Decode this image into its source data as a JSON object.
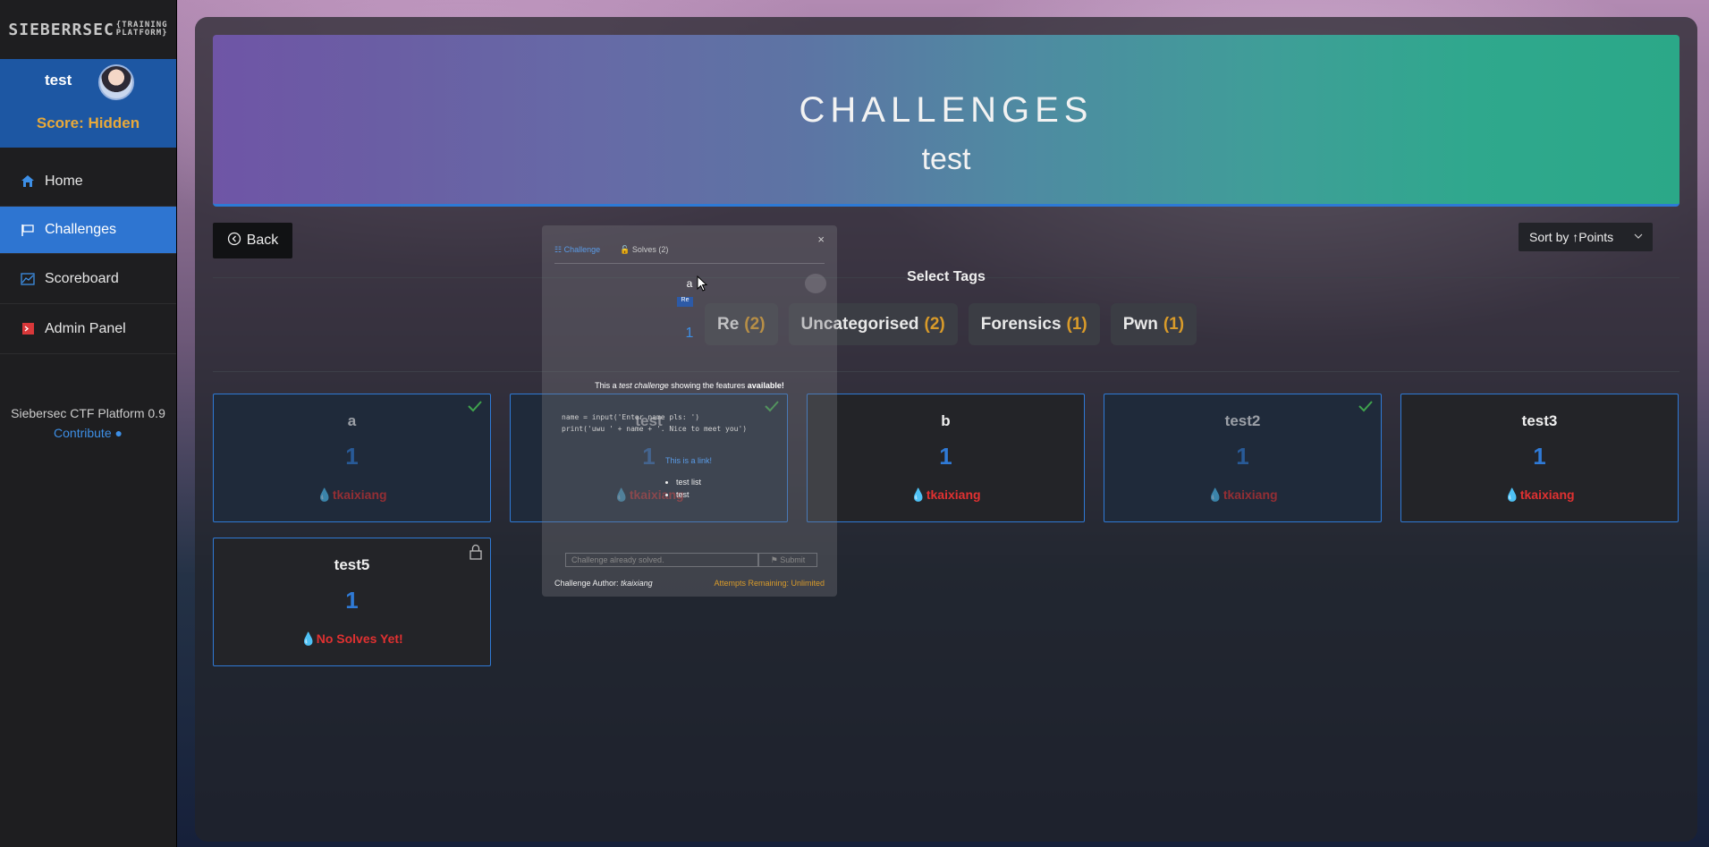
{
  "sidebar": {
    "logo_text": "SIEBERRSEC",
    "logo_sub1": "TRAINING",
    "logo_sub2": "PLATFORM",
    "username": "test",
    "score_label": "Score: Hidden",
    "nav": [
      {
        "label": "Home",
        "icon": "home-icon"
      },
      {
        "label": "Challenges",
        "icon": "flag-icon"
      },
      {
        "label": "Scoreboard",
        "icon": "chart-icon"
      },
      {
        "label": "Admin Panel",
        "icon": "terminal-icon"
      }
    ],
    "version": "Siebersec CTF Platform 0.9",
    "contribute": "Contribute"
  },
  "header": {
    "title": "CHALLENGES",
    "subtitle": "test"
  },
  "toolbar": {
    "back": "Back",
    "sort": "Sort by ↑Points"
  },
  "tags": {
    "title": "Select Tags",
    "items": [
      {
        "label": "Re",
        "count": "(2)"
      },
      {
        "label": "Uncategorised",
        "count": "(2)"
      },
      {
        "label": "Forensics",
        "count": "(1)"
      },
      {
        "label": "Pwn",
        "count": "(1)"
      }
    ]
  },
  "cards": [
    {
      "name": "a",
      "points": "1",
      "blood": "tkaixiang",
      "solved": true
    },
    {
      "name": "test",
      "points": "1",
      "blood": "tkaixiang",
      "solved": true
    },
    {
      "name": "b",
      "points": "1",
      "blood": "tkaixiang",
      "solved": false
    },
    {
      "name": "test2",
      "points": "1",
      "blood": "tkaixiang",
      "solved": true
    },
    {
      "name": "test3",
      "points": "1",
      "blood": "tkaixiang",
      "solved": false
    },
    {
      "name": "test5",
      "points": "1",
      "blood": "No Solves Yet!",
      "solved": false,
      "locked": true
    }
  ],
  "modal": {
    "close": "×",
    "tab_challenge": "Challenge",
    "tab_solves": "Solves (2)",
    "title": "a",
    "badge": "Re",
    "points": "1",
    "desc_prefix": "This a ",
    "desc_em1": "test",
    "desc_mid": " challenge",
    "desc_rest": " showing the features ",
    "desc_bold": "available!",
    "code": "name = input('Enter name pls: ')\nprint('uwu ' + name + '. Nice to meet you')",
    "link": "This is a link!",
    "bullet1": "test list",
    "bullet2": "test",
    "flag_placeholder": "Challenge already solved.",
    "submit": "Submit",
    "author_label": "Challenge Author: ",
    "author": "tkaixiang",
    "attempts": "Attempts Remaining: Unlimited"
  }
}
